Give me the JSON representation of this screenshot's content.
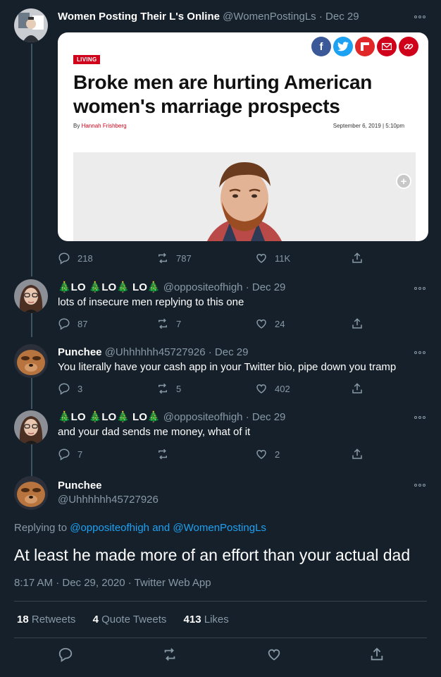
{
  "colors": {
    "background": "#15202b",
    "text": "#ffffff",
    "muted": "#8899a6",
    "link": "#1da1f2",
    "divider": "#38444d"
  },
  "tweet1": {
    "name": "Women Posting Their L's Online",
    "handle": "@WomenPostingLs",
    "date": "Dec 29",
    "card": {
      "tag": "LIVING",
      "headline": "Broke men are hurting American women's marriage prospects",
      "byline_prefix": "By",
      "author": "Hannah Frishberg",
      "pubdate": "September 6, 2019 | 5:10pm",
      "share_icons": [
        "facebook-icon",
        "twitter-icon",
        "flipboard-icon",
        "email-icon",
        "link-icon"
      ]
    },
    "replies": "218",
    "retweets": "787",
    "likes": "11K"
  },
  "tweet2": {
    "name": "🎄LO 🎄LO🎄 LO🎄",
    "handle": "@oppositeofhigh",
    "date": "Dec 29",
    "text": "lots of insecure men replying to this one",
    "replies": "87",
    "retweets": "7",
    "likes": "24"
  },
  "tweet3": {
    "name": "Punchee",
    "handle": "@Uhhhhhh45727926",
    "date": "Dec 29",
    "text": "You literally have your cash app in your Twitter bio, pipe down you tramp",
    "replies": "3",
    "retweets": "5",
    "likes": "402"
  },
  "tweet4": {
    "name": "🎄LO 🎄LO🎄 LO🎄",
    "handle": "@oppositeofhigh",
    "date": "Dec 29",
    "text": "and your dad sends me money, what of it",
    "replies": "7",
    "retweets": "",
    "likes": "2"
  },
  "main": {
    "name": "Punchee",
    "handle": "@Uhhhhhh45727926",
    "replying_label": "Replying to",
    "replying_to_1": "@oppositeofhigh",
    "replying_and": "and",
    "replying_to_2": "@WomenPostingLs",
    "text": "At least he made more of an effort than your actual dad",
    "timestamp": "8:17 AM · Dec 29, 2020 · Twitter Web App",
    "retweets_count": "18",
    "retweets_label": "Retweets",
    "quotes_count": "4",
    "quotes_label": "Quote Tweets",
    "likes_count": "413",
    "likes_label": "Likes"
  },
  "separator": "·"
}
